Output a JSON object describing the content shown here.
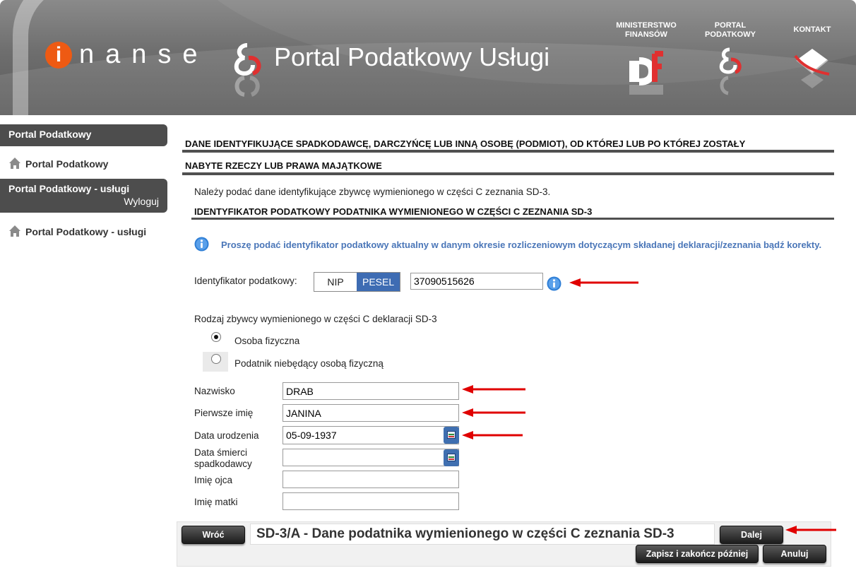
{
  "header": {
    "logo_letter": "i",
    "logo_word": "nanse",
    "title": "Portal Podatkowy Usługi",
    "links": [
      {
        "line1": "MINISTERSTWO",
        "line2": "FINANSÓW"
      },
      {
        "line1": "PORTAL",
        "line2": "PODATKOWY"
      },
      {
        "line1": "KONTAKT",
        "line2": ""
      }
    ]
  },
  "sidebar": {
    "section1_title": "Portal Podatkowy",
    "section1_item": "Portal Podatkowy",
    "section2_title": "Portal Podatkowy - usługi",
    "logout": "Wyloguj",
    "section2_item": "Portal Podatkowy - usługi"
  },
  "main": {
    "heading_line1": "DANE IDENTYFIKUJĄCE SPADKODAWCĘ, DARCZYŃCĘ LUB INNĄ OSOBĘ (PODMIOT), OD KTÓREJ LUB PO KTÓREJ ZOSTAŁY",
    "heading_line2": "NABYTE RZECZY LUB PRAWA MAJĄTKOWE",
    "intro": "Należy podać dane identyfikujące zbywcę wymienionego w części C zeznania SD-3.",
    "subheading": "IDENTYFIKATOR PODATKOWY PODATNIKA WYMIENIONEGO W CZĘŚCI C ZEZNANIA SD-3",
    "info": "Proszę podać identyfikator podatkowy aktualny w danym okresie rozliczeniowym dotyczącym składanej deklaracji/zeznania bądź korekty.",
    "id_label": "Identyfikator podatkowy:",
    "id_opt_nip": "NIP",
    "id_opt_pesel": "PESEL",
    "id_value": "37090515626",
    "type_label": "Rodzaj zbywcy wymienionego w części C deklaracji SD-3",
    "type_opt1": "Osoba fizyczna",
    "type_opt2": "Podatnik niebędący osobą fizyczną",
    "fields": {
      "surname_label": "Nazwisko",
      "surname_value": "DRAB",
      "firstname_label": "Pierwsze imię",
      "firstname_value": "JANINA",
      "birth_label": "Data urodzenia",
      "birth_value": "05-09-1937",
      "death_label_line1": "Data śmierci",
      "death_label_line2": "spadkodawcy",
      "death_value": "",
      "father_label": "Imię ojca",
      "father_value": "",
      "mother_label": "Imię matki",
      "mother_value": ""
    }
  },
  "footer": {
    "back": "Wróć",
    "step_title": "SD-3/A - Dane podatnika wymienionego w części C zeznania SD-3",
    "next": "Dalej",
    "save": "Zapisz i zakończ później",
    "cancel": "Anuluj"
  },
  "colors": {
    "accent_orange": "#ee5a13",
    "info_blue": "#4a76b8",
    "toggle_selected": "#3e6cb3",
    "arrow_red": "#e00000"
  }
}
